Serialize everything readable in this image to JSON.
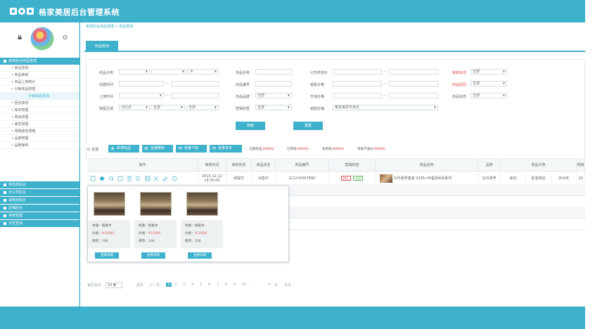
{
  "app": {
    "title": "格家美居后台管理系统"
  },
  "sidebar": {
    "sections": [
      {
        "label": "系统后台商品管理"
      },
      {
        "label": "供应商后台"
      },
      {
        "label": "分公司后台"
      },
      {
        "label": "采购商后台"
      },
      {
        "label": "店铺后台"
      },
      {
        "label": "系统管理"
      },
      {
        "label": "日志查询"
      }
    ],
    "items": [
      {
        "label": "• 商品查询"
      },
      {
        "label": "• 商品审核"
      },
      {
        "label": "• 商品上架统计"
      },
      {
        "label": "• 分销商品管理"
      },
      {
        "label": "分销商品查询"
      },
      {
        "label": "• 回访案例"
      },
      {
        "label": "• 库存管理"
      },
      {
        "label": "• 类目管理"
      },
      {
        "label": "• 属性管理"
      },
      {
        "label": "• 规格属性规格"
      },
      {
        "label": "• 品牌管理"
      },
      {
        "label": "• 品牌审核"
      }
    ]
  },
  "breadcrumb": "系统后台商品管理 > 商品查询",
  "tab": {
    "label": "商品查询"
  },
  "filters": {
    "row1": {
      "cat": "商品分类",
      "cat_v": "木",
      "name": "商品名称",
      "price": "公司供货价",
      "audit": "审核状态",
      "audit_v": "全部"
    },
    "row2": {
      "created": "创建时间",
      "code": "商品编号",
      "sale_price": "销售价格",
      "reject": "商品驳回",
      "reject_v": "全部"
    },
    "row3": {
      "shelf": "上架时间",
      "brand": "商品品牌",
      "brand_v": "全部",
      "market": "市场价格",
      "status": "商品状态",
      "status_v": "全部"
    },
    "row4": {
      "region": "销售区域",
      "province": "河北省",
      "city": "全部",
      "district": "全部",
      "tag": "营销标签",
      "tag_v": "全部",
      "store": "销售店铺",
      "store_v": "格家美居专卖店"
    },
    "search_btn": "搜索",
    "reset_btn": "重置"
  },
  "toolbar": {
    "select_all": "全选",
    "add": "新增商品",
    "batch_delete": "批量删除",
    "batch_offshelf": "批量下架",
    "batch_onshelf": "批量发布",
    "all_label": "全部商品",
    "all_n": "(88888)",
    "ok_label": "已审核",
    "ok_n": "(88888)",
    "pending_label": "未审核",
    "pending_n": "(88888)",
    "fail_label": "审核不通过",
    "fail_n": "(88888)"
  },
  "table": {
    "headers": [
      "操作",
      "审核时间",
      "审核状态",
      "商品状态",
      "商品编号",
      "营销标签",
      "商品名称",
      "品牌",
      "商品分类",
      "规格"
    ],
    "row": {
      "time": "2015-12-12 18:30:00",
      "audit": "待提交",
      "status": "出售中",
      "code": "G/1234567890",
      "tag1": "特价",
      "tag2": "促销",
      "name": "乌可波罗套装 5295+M酒店休闲系列",
      "brand": "乌可波罗",
      "cat1": "家具",
      "cat2": "卧室家具",
      "cat3": "实木床",
      "spec": "20"
    }
  },
  "popup": {
    "cards": [
      {
        "material": "材质：核桃木",
        "price_label": "价格：",
        "price": "¥13500",
        "stock": "库存：100",
        "btn": "查看详情"
      },
      {
        "material": "材质：核桃木",
        "price_label": "价格：",
        "price": "¥13500",
        "stock": "库存：100",
        "btn": "查看详情"
      },
      {
        "material": "材质：核桃木",
        "price_label": "价格：",
        "price": "¥13500",
        "stock": "库存：100",
        "btn": "查看详情"
      }
    ]
  },
  "pager": {
    "per_page_label": "每页显示",
    "per_page": "10",
    "first": "首页",
    "prev": "上一页",
    "pages": [
      "1",
      "2",
      "3",
      "4",
      "5",
      "6",
      "7",
      "8",
      "9",
      "10"
    ],
    "ellipsis": "...",
    "next": "下一页",
    "last": "末页",
    "current_page": "1"
  },
  "colors": {
    "accent": "#3eb1cc",
    "danger": "#d9534f"
  }
}
